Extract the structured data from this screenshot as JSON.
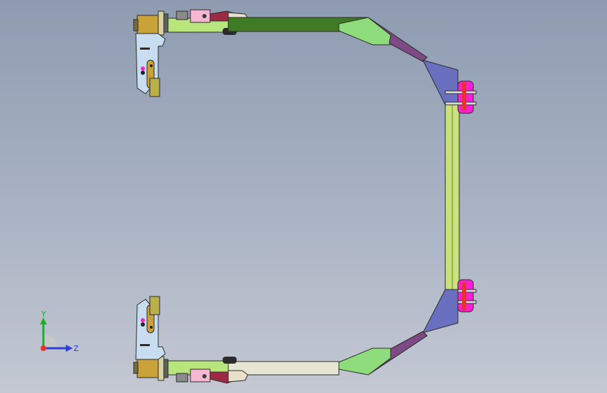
{
  "viewport": {
    "background_top": "#8e9bb0",
    "background_bottom": "#c3c8d2"
  },
  "colors": {
    "frame_outline": "#2b2b2b",
    "straight_arm_top": "#3f7a25",
    "straight_arm_bottom": "#e6e6d2",
    "light_green_segment": "#8fdc7c",
    "purple_segment": "#7d4a86",
    "blue_purple_segment": "#6b6fc0",
    "yellow_green_rail": "#c9e37a",
    "magenta_clamp": "#ff1ed2",
    "red_pin": "#e8332a",
    "end_block_tan": "#c9a23a",
    "light_blue_bracket": "#c8def0",
    "pink_block": "#f7b6d2",
    "arm_light_green": "#b9e67c"
  },
  "triad": {
    "y_label": "Y",
    "z_label": "Z",
    "y_color": "#1fae2b",
    "z_color": "#2e3fd6",
    "origin_color": "#e8332a"
  },
  "icons": {
    "triad": "coordinate-axis-triad-icon"
  }
}
